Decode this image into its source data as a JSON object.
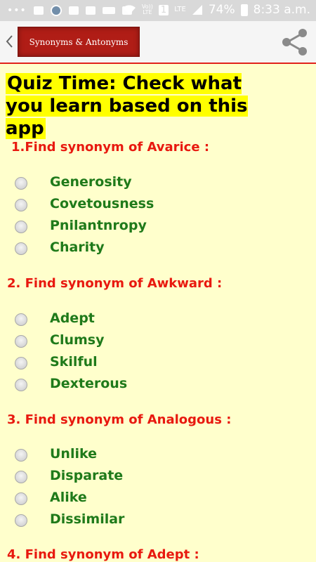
{
  "status_bar": {
    "battery": "74%",
    "time": "8:33 a.m.",
    "network_top": "Vo))",
    "network_bottom": "LTE",
    "sim": "1",
    "lte": "LTE",
    "icons": [
      "more-icon",
      "gallery-icon",
      "news-icon",
      "mail-icon",
      "mail-icon",
      "news-icon",
      "gallery-icon",
      "wifi-icon",
      "signal-icon",
      "battery-icon"
    ]
  },
  "app_bar": {
    "title": "Synonyms & Antonyms",
    "back_icon": "chevron-left-icon",
    "share_icon": "share-icon"
  },
  "quiz": {
    "heading": "Quiz Time: Check what you learn based on this app",
    "questions": [
      {
        "text": "1.Find synonym of Avarice :",
        "options": [
          "Generosity",
          "Covetousness",
          "Pnilantnropy",
          "Charity"
        ]
      },
      {
        "text": "2. Find synonym of Awkward :",
        "options": [
          "Adept",
          "Clumsy",
          "Skilful",
          "Dexterous"
        ]
      },
      {
        "text": "3. Find synonym of Analogous :",
        "options": [
          "Unlike",
          "Disparate",
          "Alike",
          "Dissimilar"
        ]
      },
      {
        "text": "4. Find synonym of Adept :",
        "options": []
      }
    ]
  },
  "colors": {
    "background": "#ffffcc",
    "question": "#e8190f",
    "option": "#1f7a1a",
    "highlight": "#ffff00",
    "banner": "#b01d16",
    "accent_line": "#e0221c"
  }
}
